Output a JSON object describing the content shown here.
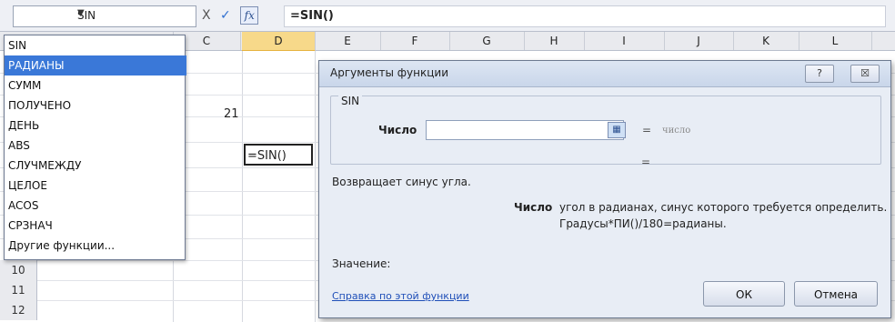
{
  "formula_bar": {
    "name_box": "SIN",
    "cancel": "X",
    "enter": "✓",
    "fx": "fx",
    "formula": "=SIN()"
  },
  "columns": [
    "C",
    "D",
    "E",
    "F",
    "G",
    "H",
    "I",
    "J",
    "K",
    "L"
  ],
  "selected_column": "D",
  "rows": [
    "10",
    "11",
    "12"
  ],
  "function_list": [
    "SIN",
    "РАДИАНЫ",
    "СУММ",
    "ПОЛУЧЕНО",
    "ДЕНЬ",
    "ABS",
    "СЛУЧМЕЖДУ",
    "ЦЕЛОЕ",
    "ACOS",
    "СРЗНАЧ",
    "Другие функции..."
  ],
  "highlighted_function": "РАДИАНЫ",
  "cells": {
    "c_value": "21",
    "d_editing": "=SIN()"
  },
  "dialog": {
    "title": "Аргументы функции",
    "help_glyph": "?",
    "close_glyph": "☒",
    "function_name": "SIN",
    "arg_label": "Число",
    "arg_value": "",
    "arg_hint": "число",
    "eq1": "=",
    "eq2": "=",
    "description": "Возвращает синус угла.",
    "arg_desc_label": "Число",
    "arg_desc_line1": "угол в радианах, синус которого требуется определить.",
    "arg_desc_line2": "Градусы*ПИ()/180=радианы.",
    "value_label": "Значение:",
    "help_link": "Справка по этой функции",
    "ok": "ОК",
    "cancel": "Отмена"
  }
}
